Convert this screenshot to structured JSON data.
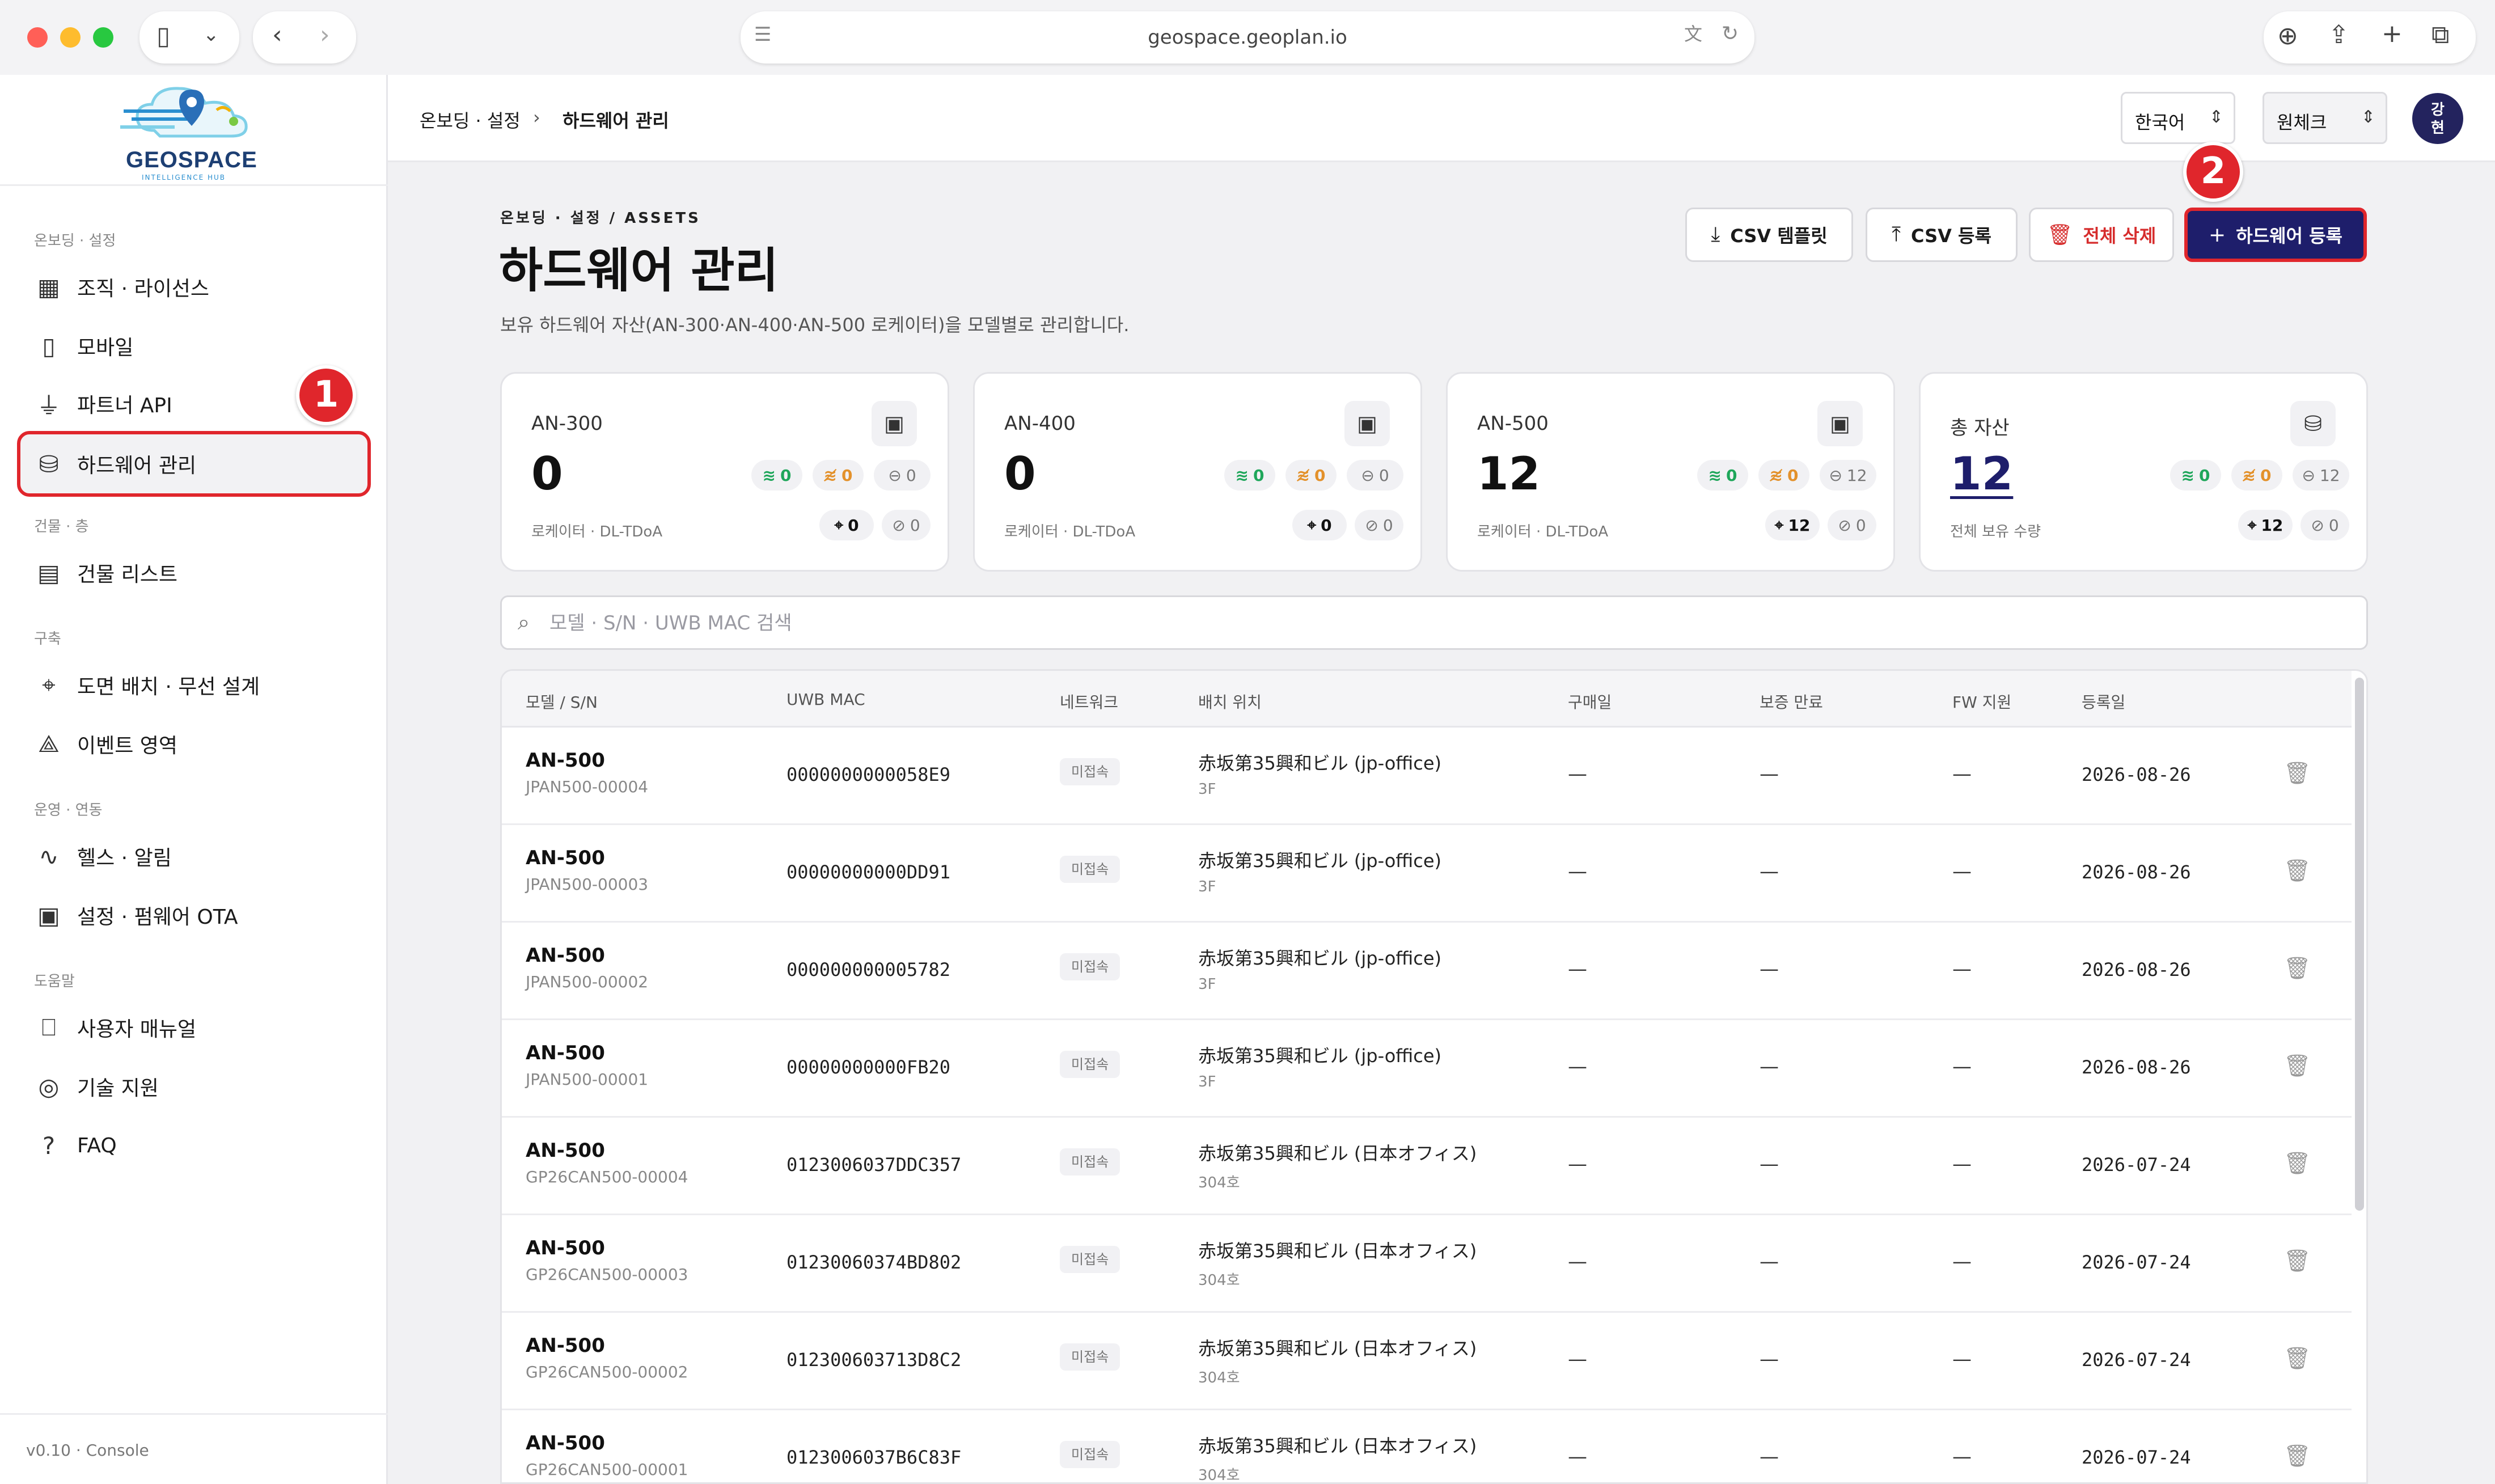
{
  "browser": {
    "url": "geospace.geoplan.io"
  },
  "logo": {
    "name": "GEOSPACE",
    "tagline": "INTELLIGENCE HUB"
  },
  "sidebar": {
    "sections": [
      {
        "label": "온보딩 · 설정"
      },
      {
        "label": "건물 · 층"
      },
      {
        "label": "구축"
      },
      {
        "label": "운영 · 연동"
      },
      {
        "label": "도움말"
      }
    ],
    "items": [
      {
        "label": "조직 · 라이선스",
        "icon": "building-icon"
      },
      {
        "label": "모바일",
        "icon": "mobile-icon"
      },
      {
        "label": "파트너 API",
        "icon": "plug-icon"
      },
      {
        "label": "하드웨어 관리",
        "icon": "hard-drive-icon"
      },
      {
        "label": "건물 리스트",
        "icon": "building-list-icon"
      },
      {
        "label": "도면 배치 · 무선 설계",
        "icon": "map-pin-icon"
      },
      {
        "label": "이벤트 영역",
        "icon": "shapes-icon"
      },
      {
        "label": "헬스 · 알림",
        "icon": "activity-icon"
      },
      {
        "label": "설정 · 펌웨어 OTA",
        "icon": "chip-icon"
      },
      {
        "label": "사용자 매뉴얼",
        "icon": "book-icon"
      },
      {
        "label": "기술 지원",
        "icon": "lifebuoy-icon"
      },
      {
        "label": "FAQ",
        "icon": "help-circle-icon"
      }
    ],
    "footer": "v0.10 · Console"
  },
  "annotations": {
    "step1": "1",
    "step2": "2"
  },
  "topbar": {
    "breadcrumb": [
      "온보딩 · 설정",
      "하드웨어 관리"
    ],
    "language": "한국어",
    "org": "원체크",
    "avatar_line1": "강",
    "avatar_line2": "현"
  },
  "page": {
    "eyebrow": "온보딩 · 설정 / ASSETS",
    "title": "하드웨어 관리",
    "description": "보유 하드웨어 자산(AN-300·AN-400·AN-500 로케이터)을 모델별로 관리합니다.",
    "buttons": {
      "csv_template": "CSV 템플릿",
      "csv_import": "CSV 등록",
      "delete_all": "전체 삭제",
      "register": "하드웨어 등록"
    }
  },
  "stats": [
    {
      "name": "AN-300",
      "count": "0",
      "sub": "로케이터 · DL-TDoA",
      "online": "0",
      "offline": "0",
      "idle": "0",
      "placed": "0",
      "unplaced": "0"
    },
    {
      "name": "AN-400",
      "count": "0",
      "sub": "로케이터 · DL-TDoA",
      "online": "0",
      "offline": "0",
      "idle": "0",
      "placed": "0",
      "unplaced": "0"
    },
    {
      "name": "AN-500",
      "count": "12",
      "sub": "로케이터 · DL-TDoA",
      "online": "0",
      "offline": "0",
      "idle": "12",
      "placed": "12",
      "unplaced": "0"
    },
    {
      "name": "총 자산",
      "count": "12",
      "sub": "전체 보유 수량",
      "online": "0",
      "offline": "0",
      "idle": "12",
      "placed": "12",
      "unplaced": "0"
    }
  ],
  "search": {
    "placeholder": "모델 · S/N · UWB MAC 검색"
  },
  "table": {
    "headers": [
      "모델 / S/N",
      "UWB MAC",
      "네트워크",
      "배치 위치",
      "구매일",
      "보증 만료",
      "FW 지원",
      "등록일"
    ],
    "rows": [
      {
        "model": "AN-500",
        "sn": "JPAN500-00004",
        "mac": "0000000000058E9",
        "network": "미접속",
        "location": "赤坂第35興和ビル (jp-office)",
        "floor": "3F",
        "purchase": "—",
        "warranty": "—",
        "fw": "—",
        "registered": "2026-08-26"
      },
      {
        "model": "AN-500",
        "sn": "JPAN500-00003",
        "mac": "00000000000DD91",
        "network": "미접속",
        "location": "赤坂第35興和ビル (jp-office)",
        "floor": "3F",
        "purchase": "—",
        "warranty": "—",
        "fw": "—",
        "registered": "2026-08-26"
      },
      {
        "model": "AN-500",
        "sn": "JPAN500-00002",
        "mac": "000000000005782",
        "network": "미접속",
        "location": "赤坂第35興和ビル (jp-office)",
        "floor": "3F",
        "purchase": "—",
        "warranty": "—",
        "fw": "—",
        "registered": "2026-08-26"
      },
      {
        "model": "AN-500",
        "sn": "JPAN500-00001",
        "mac": "00000000000FB20",
        "network": "미접속",
        "location": "赤坂第35興和ビル (jp-office)",
        "floor": "3F",
        "purchase": "—",
        "warranty": "—",
        "fw": "—",
        "registered": "2026-08-26"
      },
      {
        "model": "AN-500",
        "sn": "GP26CAN500-00004",
        "mac": "0123006037DDC357",
        "network": "미접속",
        "location": "赤坂第35興和ビル (日本オフィス)",
        "floor": "304호",
        "purchase": "—",
        "warranty": "—",
        "fw": "—",
        "registered": "2026-07-24"
      },
      {
        "model": "AN-500",
        "sn": "GP26CAN500-00003",
        "mac": "01230060374BD802",
        "network": "미접속",
        "location": "赤坂第35興和ビル (日本オフィス)",
        "floor": "304호",
        "purchase": "—",
        "warranty": "—",
        "fw": "—",
        "registered": "2026-07-24"
      },
      {
        "model": "AN-500",
        "sn": "GP26CAN500-00002",
        "mac": "012300603713D8C2",
        "network": "미접속",
        "location": "赤坂第35興和ビル (日本オフィス)",
        "floor": "304호",
        "purchase": "—",
        "warranty": "—",
        "fw": "—",
        "registered": "2026-07-24"
      },
      {
        "model": "AN-500",
        "sn": "GP26CAN500-00001",
        "mac": "0123006037B6C83F",
        "network": "미접속",
        "location": "赤坂第35興和ビル (日本オフィス)",
        "floor": "304호",
        "purchase": "—",
        "warranty": "—",
        "fw": "—",
        "registered": "2026-07-24"
      }
    ]
  },
  "colors": {
    "primary": "#1e1e6b",
    "annotation": "#e0262c",
    "online": "#1ea65a",
    "offline": "#e3912b"
  }
}
